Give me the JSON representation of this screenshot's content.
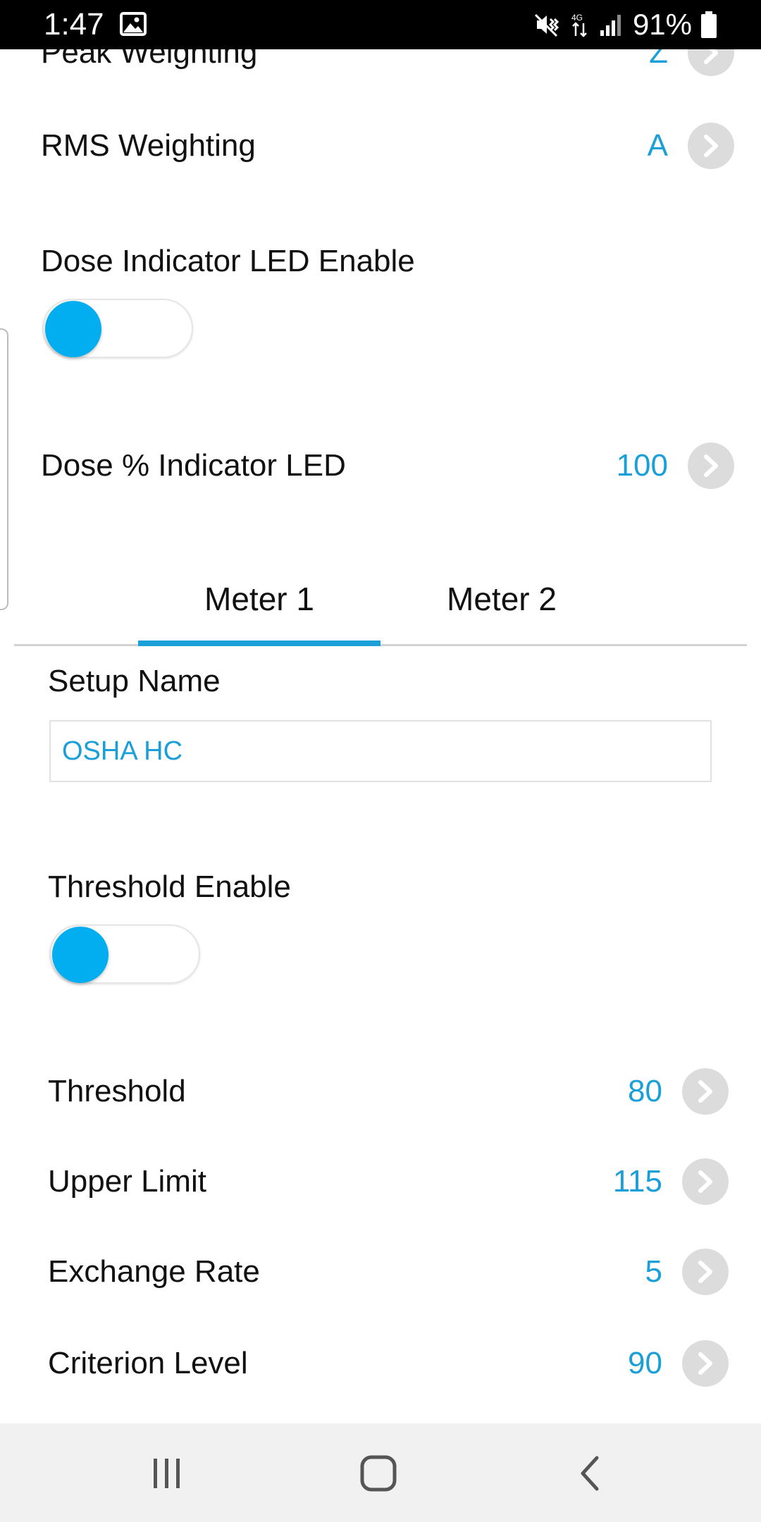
{
  "status_bar": {
    "time": "1:47",
    "battery_percent": "91%",
    "icons": [
      "image-icon",
      "mute-vibrate-icon",
      "data-transfer-icon",
      "signal-icon",
      "battery-icon"
    ]
  },
  "top_settings": [
    {
      "label": "Peak Weighting",
      "value": "Z"
    },
    {
      "label": "RMS Weighting",
      "value": "A"
    }
  ],
  "dose_led_enable": {
    "label": "Dose Indicator LED Enable",
    "enabled": false
  },
  "dose_led_percent": {
    "label": "Dose % Indicator LED",
    "value": "100"
  },
  "tabs": [
    {
      "label": "Meter 1",
      "active": true
    },
    {
      "label": "Meter 2",
      "active": false
    }
  ],
  "meter": {
    "setup_name_label": "Setup Name",
    "setup_name_value": "OSHA HC",
    "threshold_enable_label": "Threshold Enable",
    "threshold_enabled": false,
    "settings": [
      {
        "label": "Threshold",
        "value": "80"
      },
      {
        "label": "Upper Limit",
        "value": "115"
      },
      {
        "label": "Exchange Rate",
        "value": "5"
      },
      {
        "label": "Criterion Level",
        "value": "90"
      }
    ]
  },
  "nav_bar": {
    "icons": [
      "recent-apps-icon",
      "home-icon",
      "back-icon"
    ]
  },
  "colors": {
    "accent": "#1a9fd9",
    "toggle_knob": "#03aef0",
    "chevron_button": "#dcdcdc",
    "nav_background": "#f1f1f1"
  }
}
